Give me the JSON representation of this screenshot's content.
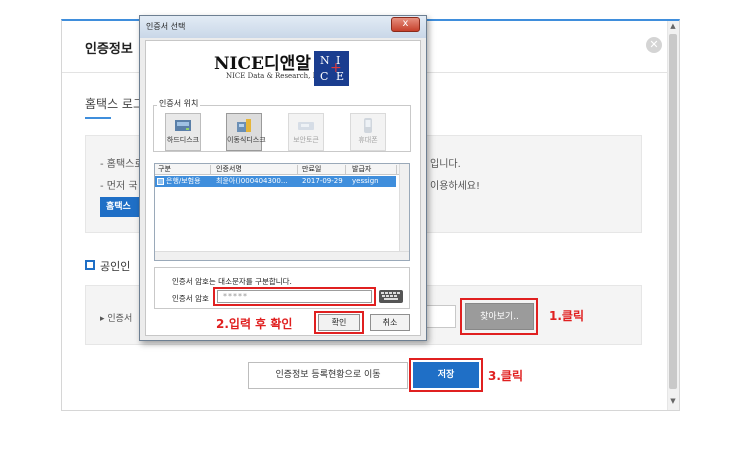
{
  "page": {
    "panel_title": "인증정보",
    "hometax_login_title": "홈택스 로그",
    "info_lines": [
      "- 홈택스로",
      "- 먼저 국"
    ],
    "info_line_ends": [
      "입니다.",
      "이용하세요!"
    ],
    "hometax_button": "홈택스 ",
    "cert_section_title": "공인인",
    "cert_row_label": "인증서",
    "browse_button": "찾아보기..",
    "step1_label": "1.클릭",
    "status_button": "인증정보 등록현황으로 이동",
    "save_button": "저장",
    "step3_label": "3.클릭",
    "accent_color": "#1f6fc6",
    "annotation_color": "#e02020"
  },
  "dialog": {
    "title": "인증서 선택",
    "close_glyph": "x",
    "logo_text": "NICE디앤알",
    "logo_subtitle": "NICE Data & Research, Inc",
    "logo_letters": [
      "N",
      "I",
      "C",
      "E"
    ],
    "location_legend": "인증서 위치",
    "storage": [
      {
        "label": "하드디스크",
        "icon": "hard-disk-icon",
        "enabled": true
      },
      {
        "label": "이동식디스크",
        "icon": "removable-disk-icon",
        "enabled": true,
        "selected": true
      },
      {
        "label": "보안토큰",
        "icon": "security-token-icon",
        "enabled": false
      },
      {
        "label": "휴대폰",
        "icon": "mobile-phone-icon",
        "enabled": false
      }
    ],
    "table": {
      "headers": [
        "구분",
        "인증서명",
        "만료일",
        "발급자"
      ],
      "rows": [
        {
          "type": "은행/보험용",
          "name": "최윤아()000404300...",
          "expiry": "2017-09-29",
          "issuer": "yessign"
        }
      ]
    },
    "password_note": "인증서 암호는 대소문자를 구분합니다.",
    "password_label": "인증서 암호",
    "password_value": "*****",
    "step2_label": "2.입력 후 확인",
    "ok_button": "확인",
    "cancel_button": "취소"
  }
}
